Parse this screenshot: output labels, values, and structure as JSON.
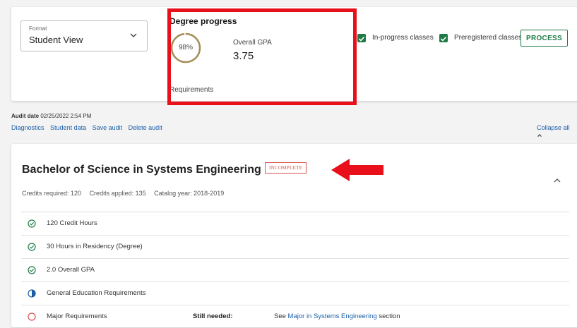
{
  "format": {
    "label": "Format",
    "value": "Student View"
  },
  "degree_progress": {
    "title": "Degree progress",
    "percent": 98,
    "percent_label": "98%",
    "gpa_label": "Overall GPA",
    "gpa_value": "3.75",
    "requirements_label": "Requirements"
  },
  "options": {
    "in_progress": {
      "label": "In-progress classes",
      "checked": true
    },
    "preregistered": {
      "label": "Preregistered classes",
      "checked": true
    },
    "process_label": "PROCESS"
  },
  "audit": {
    "date_label": "Audit date",
    "date_value": "02/25/2022 2:54 PM",
    "links": [
      "Diagnostics",
      "Student data",
      "Save audit",
      "Delete audit"
    ],
    "collapse_all": "Collapse all"
  },
  "degree": {
    "title": "Bachelor of Science in Systems Engineering",
    "status": "INCOMPLETE",
    "credits_required": "Credits required: 120",
    "credits_applied": "Credits applied: 135",
    "catalog_year": "Catalog year: 2018-2019"
  },
  "requirements": [
    {
      "name": "120 Credit Hours",
      "status": "complete-check-icon"
    },
    {
      "name": "30 Hours in Residency (Degree)",
      "status": "complete-check-icon"
    },
    {
      "name": "2.0 Overall GPA",
      "status": "complete-check-icon"
    },
    {
      "name": "General Education Requirements",
      "status": "in-progress-half-circle-icon"
    },
    {
      "name": "Major Requirements",
      "status": "incomplete-circle-icon",
      "still_needed": "Still needed:",
      "see_prefix": "See",
      "see_link": "Major in Systems Engineering",
      "see_suffix": "section"
    }
  ],
  "colors": {
    "accent_green": "#1f7a45",
    "link_blue": "#1a5ea8",
    "incomplete_red": "#d9534f",
    "annotation_red": "#e8101a",
    "progress_ring": "#a58d58"
  }
}
